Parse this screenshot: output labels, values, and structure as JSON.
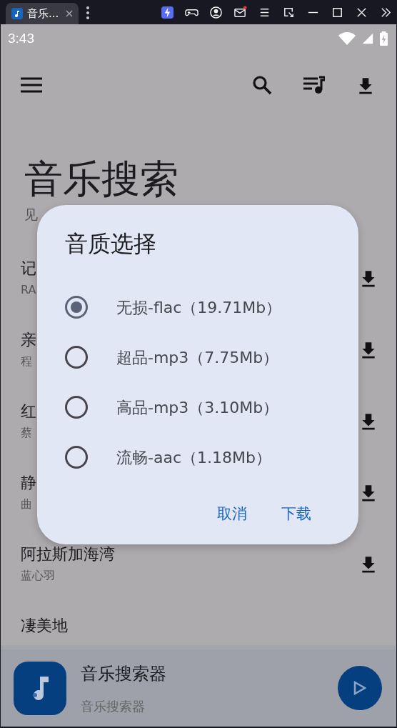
{
  "browser_tab": {
    "title": "音乐...",
    "selected": true
  },
  "status_bar": {
    "time": "3:43"
  },
  "header": {
    "title": "音乐搜索",
    "subtitle": "见"
  },
  "songs": [
    {
      "title": "记",
      "artist": "RA"
    },
    {
      "title": "亲",
      "artist": "程"
    },
    {
      "title": "红",
      "artist": "蔡"
    },
    {
      "title": "静",
      "artist": "曲"
    },
    {
      "title": "阿拉斯加海湾",
      "artist": "蓝心羽"
    },
    {
      "title": "凄美地"
    }
  ],
  "dialog": {
    "title": "音质选择",
    "options": [
      {
        "label": "无损-flac（19.71Mb）",
        "selected": true
      },
      {
        "label": "超品-mp3（7.75Mb）",
        "selected": false
      },
      {
        "label": "高品-mp3（3.10Mb）",
        "selected": false
      },
      {
        "label": "流畅-aac（1.18Mb）",
        "selected": false
      }
    ],
    "buttons": [
      "取消",
      "下载"
    ]
  },
  "player": {
    "title": "音乐搜索器",
    "subtitle": "音乐搜索器"
  }
}
